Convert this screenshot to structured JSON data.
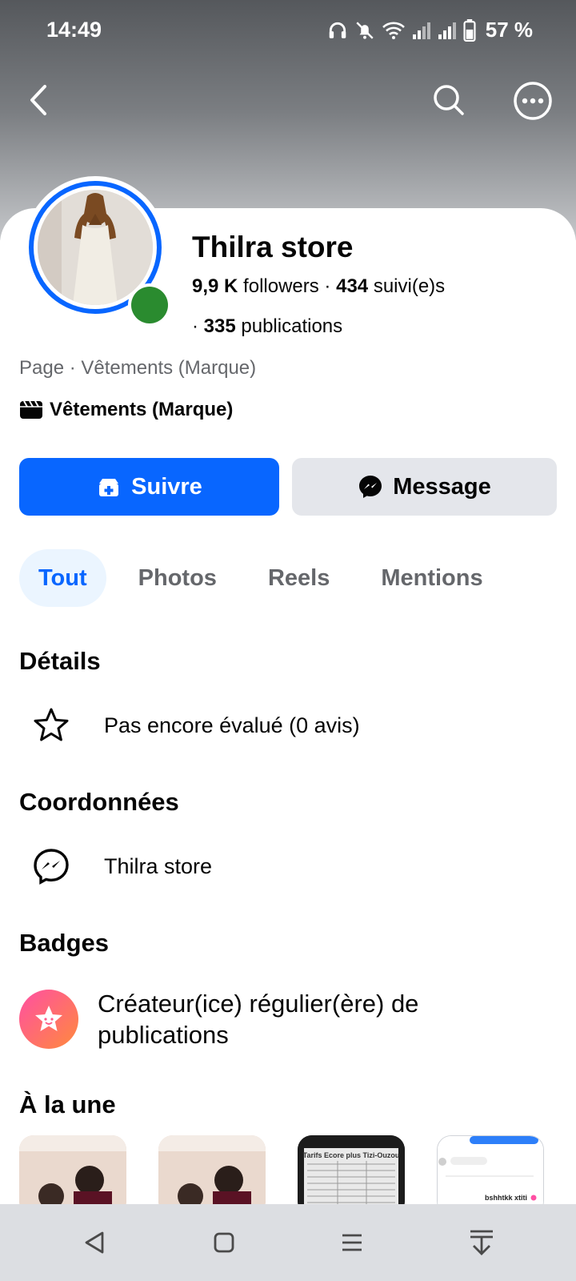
{
  "status_bar": {
    "time": "14:49",
    "battery": "57 %"
  },
  "profile": {
    "name": "Thilra store",
    "followers_count": "9,9 K",
    "followers_label": "followers",
    "following_count": "434",
    "following_label": "suivi(e)s",
    "publications_count": "335",
    "publications_label": "publications",
    "category_line": "Page · Vêtements (Marque)",
    "brand_label": "Vêtements (Marque)"
  },
  "actions": {
    "follow_label": "Suivre",
    "message_label": "Message"
  },
  "tabs": [
    {
      "label": "Tout",
      "active": true
    },
    {
      "label": "Photos",
      "active": false
    },
    {
      "label": "Reels",
      "active": false
    },
    {
      "label": "Mentions",
      "active": false
    }
  ],
  "sections": {
    "details_title": "Détails",
    "rating_text": "Pas encore évalué (0 avis)",
    "contact_title": "Coordonnées",
    "contact_messenger": "Thilra store",
    "badges_title": "Badges",
    "badge_text": "Créateur(ice) régulier(ère) de publications",
    "featured_title": "À la une"
  },
  "featured_thumbs": {
    "third_caption": "Tarifs Ecore plus Tizi-Ouzou",
    "fourth_caption": "bshhtkk xtiti"
  },
  "colors": {
    "accent": "#0866ff",
    "online": "#2a8b2f",
    "secondary_button": "#e4e6eb",
    "active_tab_bg": "#ebf5ff",
    "muted_text": "#65676b"
  },
  "icons": {
    "back": "chevron-left-icon",
    "search": "search-icon",
    "more": "more-icon",
    "follow": "follow-icon",
    "messenger": "messenger-icon",
    "star": "star-icon",
    "clapper": "clapperboard-icon"
  }
}
